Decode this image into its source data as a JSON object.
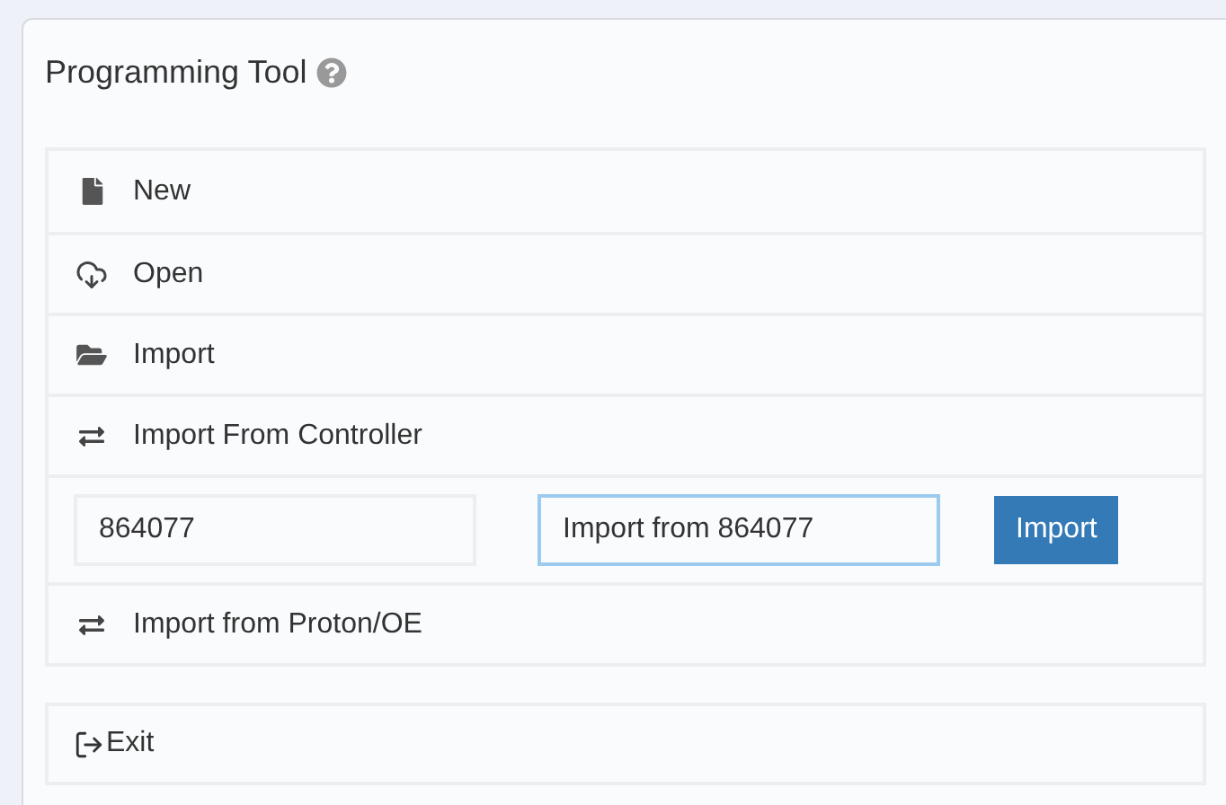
{
  "panel": {
    "title": "Programming Tool"
  },
  "menu": [
    {
      "kind": "item",
      "label": "New"
    },
    {
      "kind": "item",
      "label": "Open"
    },
    {
      "kind": "item",
      "label": "Import"
    },
    {
      "kind": "item",
      "label": "Import From Controller"
    },
    {
      "kind": "form",
      "fields": [
        {
          "value": "864077",
          "focused": false
        },
        {
          "value": "Import from 864077",
          "focused": true
        }
      ],
      "button": "Import"
    },
    {
      "kind": "item",
      "label": "Import from Proton/OE"
    }
  ],
  "exit": {
    "label": "Exit"
  }
}
